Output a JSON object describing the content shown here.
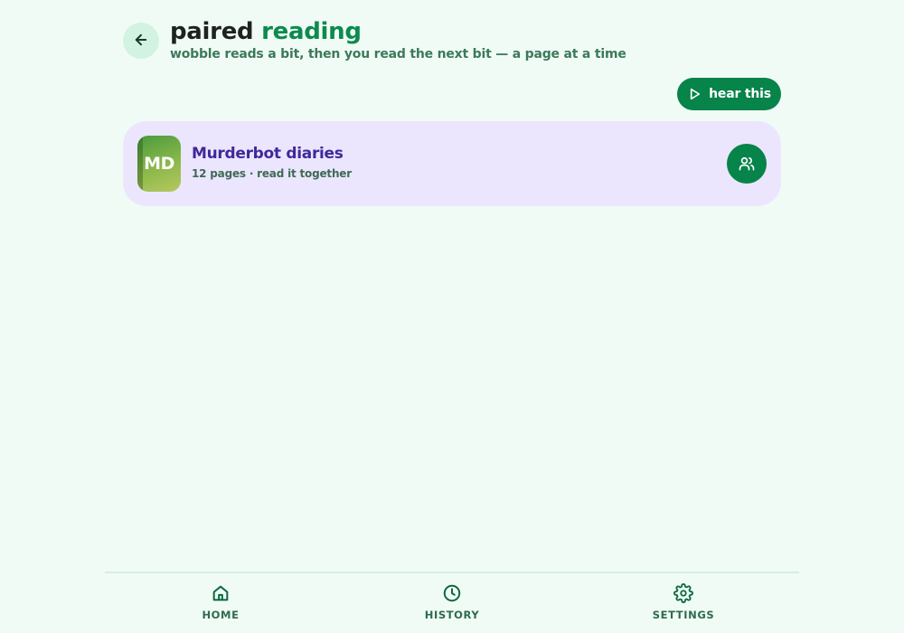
{
  "header": {
    "title_part1": "paired",
    "title_part2": "reading",
    "subtitle": "wobble reads a bit, then you read the next bit — a page at a time",
    "back_icon": "arrow-left-icon"
  },
  "actions": {
    "hear_label": "hear this",
    "hear_icon": "play-icon"
  },
  "book": {
    "cover_initials": "MD",
    "title": "Murderbot diaries",
    "meta": "12 pages · read it together",
    "pair_icon": "users-icon"
  },
  "nav": {
    "items": [
      {
        "label": "HOME",
        "icon": "home-icon"
      },
      {
        "label": "HISTORY",
        "icon": "clock-icon"
      },
      {
        "label": "SETTINGS",
        "icon": "gear-icon"
      }
    ]
  },
  "colors": {
    "background": "#f1fbf5",
    "accent": "#0c8a4f",
    "button": "#06844a",
    "card": "#ebe6fd",
    "book_title": "#40289a"
  }
}
